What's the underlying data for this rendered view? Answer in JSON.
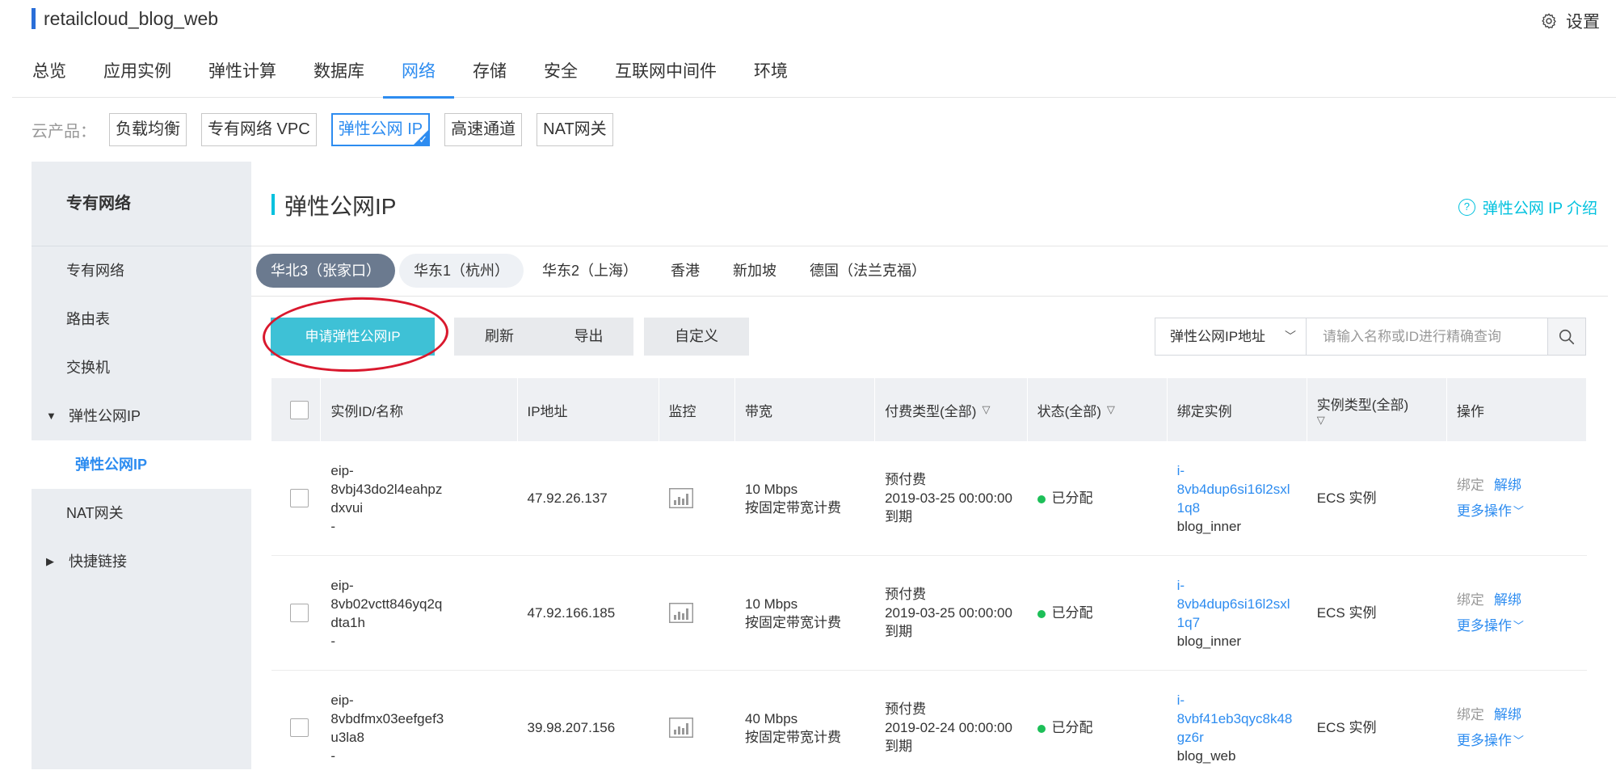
{
  "app": {
    "title": "retailcloud_blog_web",
    "settings_label": "设置"
  },
  "main_tabs": [
    {
      "label": "总览"
    },
    {
      "label": "应用实例"
    },
    {
      "label": "弹性计算"
    },
    {
      "label": "数据库"
    },
    {
      "label": "网络",
      "active": true
    },
    {
      "label": "存储"
    },
    {
      "label": "安全"
    },
    {
      "label": "互联网中间件"
    },
    {
      "label": "环境"
    }
  ],
  "products": {
    "label": "云产品：",
    "items": [
      {
        "label": "负载均衡"
      },
      {
        "label": "专有网络 VPC"
      },
      {
        "label": "弹性公网 IP",
        "active": true
      },
      {
        "label": "高速通道"
      },
      {
        "label": "NAT网关"
      }
    ]
  },
  "sidebar": {
    "title": "专有网络",
    "items": [
      {
        "label": "专有网络"
      },
      {
        "label": "路由表"
      },
      {
        "label": "交换机"
      },
      {
        "label": "弹性公网IP",
        "expanded": true
      },
      {
        "label": "弹性公网IP",
        "sub": true
      },
      {
        "label": "NAT网关"
      },
      {
        "label": "快捷链接",
        "collapsed": true
      }
    ]
  },
  "content": {
    "title": "弹性公网IP",
    "intro_link": "弹性公网 IP 介绍"
  },
  "regions": [
    {
      "label": "华北3（张家口）",
      "active": true
    },
    {
      "label": "华东1（杭州）"
    },
    {
      "label": "华东2（上海）"
    },
    {
      "label": "香港"
    },
    {
      "label": "新加坡"
    },
    {
      "label": "德国（法兰克福）"
    }
  ],
  "toolbar": {
    "apply_label": "申请弹性公网IP",
    "refresh_label": "刷新",
    "export_label": "导出",
    "custom_label": "自定义",
    "search_field": "弹性公网IP地址",
    "search_placeholder": "请输入名称或ID进行精确查询"
  },
  "table": {
    "headers": [
      "实例ID/名称",
      "IP地址",
      "监控",
      "带宽",
      "付费类型(全部)",
      "状态(全部)",
      "绑定实例",
      "实例类型(全部)",
      "操作"
    ],
    "rows": [
      {
        "id_lines": [
          "eip-",
          "8vbj43do2l4eahpz",
          "dxvui",
          "-"
        ],
        "ip": "47.92.26.137",
        "bandwidth": "10 Mbps",
        "bandwidth_type": "按固定带宽计费",
        "pay_type": "预付费",
        "pay_date": "2019-03-25 00:00:00",
        "pay_expire": "到期",
        "status": "已分配",
        "bind_lines": [
          "i-",
          "8vb4dup6si16l2sxl",
          "1q8"
        ],
        "bind_name": "blog_inner",
        "instance_type": "ECS 实例",
        "op_bind": "绑定",
        "op_unbind": "解绑",
        "op_more": "更多操作"
      },
      {
        "id_lines": [
          "eip-",
          "8vb02vctt846yq2q",
          "dta1h",
          "-"
        ],
        "ip": "47.92.166.185",
        "bandwidth": "10 Mbps",
        "bandwidth_type": "按固定带宽计费",
        "pay_type": "预付费",
        "pay_date": "2019-03-25 00:00:00",
        "pay_expire": "到期",
        "status": "已分配",
        "bind_lines": [
          "i-",
          "8vb4dup6si16l2sxl",
          "1q7"
        ],
        "bind_name": "blog_inner",
        "instance_type": "ECS 实例",
        "op_bind": "绑定",
        "op_unbind": "解绑",
        "op_more": "更多操作"
      },
      {
        "id_lines": [
          "eip-",
          "8vbdfmx03eefgef3",
          "u3la8",
          "-"
        ],
        "ip": "39.98.207.156",
        "bandwidth": "40 Mbps",
        "bandwidth_type": "按固定带宽计费",
        "pay_type": "预付费",
        "pay_date": "2019-02-24 00:00:00",
        "pay_expire": "到期",
        "status": "已分配",
        "bind_lines": [
          "i-",
          "8vbf41eb3qyc8k48",
          "gz6r"
        ],
        "bind_name": "blog_web",
        "instance_type": "ECS 实例",
        "op_bind": "绑定",
        "op_unbind": "解绑",
        "op_more": "更多操作"
      }
    ]
  },
  "colors": {
    "accent": "#2d8cf0",
    "cyan": "#3ec1d6",
    "region_active": "#6b7a8f",
    "status_ok": "#1dbf58",
    "highlight_ring": "#d9182d"
  }
}
